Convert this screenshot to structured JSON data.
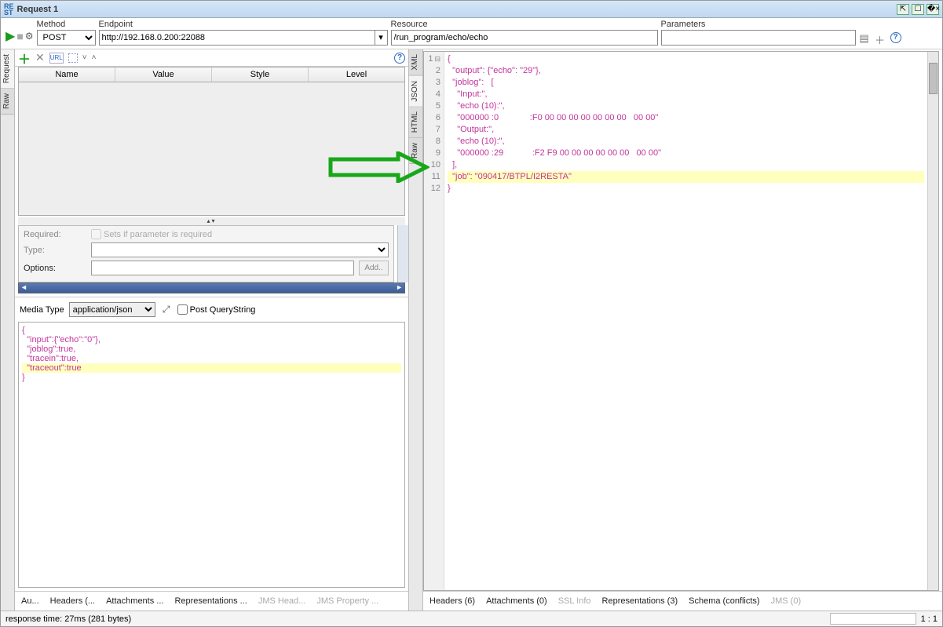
{
  "window": {
    "title": "Request 1"
  },
  "toolbar": {
    "method_label": "Method",
    "endpoint_label": "Endpoint",
    "resource_label": "Resource",
    "parameters_label": "Parameters",
    "method_value": "POST",
    "endpoint_value": "http://192.168.0.200:22088",
    "resource_value": "/run_program/echo/echo",
    "parameters_value": ""
  },
  "left_tabs": [
    "Request",
    "Raw"
  ],
  "right_tabs": [
    "XML",
    "JSON",
    "HTML",
    "Raw"
  ],
  "param_table": {
    "headers": [
      "Name",
      "Value",
      "Style",
      "Level"
    ]
  },
  "props": {
    "required_label": "Required:",
    "required_hint": "Sets if parameter is required",
    "type_label": "Type:",
    "options_label": "Options:",
    "add_label": "Add.."
  },
  "media": {
    "label": "Media Type",
    "value": "application/json",
    "post_qs_label": "Post QueryString"
  },
  "request_body_lines": [
    "{",
    "  \"input\":{\"echo\":\"0\"},",
    "  \"joblog\":true,",
    "  \"tracein\":true,",
    "  \"traceout\":true",
    "}"
  ],
  "response_lines": [
    "{",
    "  \"output\": {\"echo\": \"29\"},",
    "  \"joblog\":   [",
    "    \"Input:\",",
    "    \"echo (10):\",",
    "    \"000000 :0             :F0 00 00 00 00 00 00 00   00 00\"",
    "    \"Output:\",",
    "    \"echo (10):\",",
    "    \"000000 :29            :F2 F9 00 00 00 00 00 00   00 00\"",
    "  ],",
    "  \"job\": \"090417/BTPL/I2RESTA\"",
    "}"
  ],
  "bottom_left_tabs": [
    {
      "label": "Au...",
      "disabled": false
    },
    {
      "label": "Headers (...",
      "disabled": false
    },
    {
      "label": "Attachments ...",
      "disabled": false
    },
    {
      "label": "Representations ...",
      "disabled": false
    },
    {
      "label": "JMS Head...",
      "disabled": true
    },
    {
      "label": "JMS Property ...",
      "disabled": true
    }
  ],
  "bottom_right_tabs": [
    {
      "label": "Headers (6)",
      "disabled": false
    },
    {
      "label": "Attachments (0)",
      "disabled": false
    },
    {
      "label": "SSL Info",
      "disabled": true
    },
    {
      "label": "Representations (3)",
      "disabled": false
    },
    {
      "label": "Schema (conflicts)",
      "disabled": false
    },
    {
      "label": "JMS (0)",
      "disabled": true
    }
  ],
  "status": {
    "text": "response time: 27ms (281 bytes)",
    "pos": "1 : 1"
  }
}
